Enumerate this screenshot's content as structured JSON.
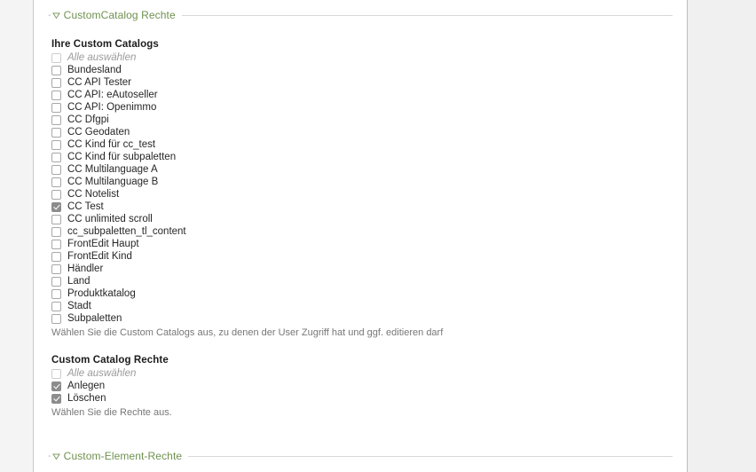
{
  "sections": [
    {
      "legend": "CustomCatalog Rechte",
      "toggle_icon": "triangle-down-icon",
      "accent_color": "#6f9150",
      "groups": [
        {
          "title": "Ihre Custom Catalogs",
          "select_all": {
            "label": "Alle auswählen",
            "checked": false
          },
          "options": [
            {
              "label": "Bundesland",
              "checked": false
            },
            {
              "label": "CC API Tester",
              "checked": false
            },
            {
              "label": "CC API: eAutoseller",
              "checked": false
            },
            {
              "label": "CC API: Openimmo",
              "checked": false
            },
            {
              "label": "CC Dfgpi",
              "checked": false
            },
            {
              "label": "CC Geodaten",
              "checked": false
            },
            {
              "label": "CC Kind für cc_test",
              "checked": false
            },
            {
              "label": "CC Kind für subpaletten",
              "checked": false
            },
            {
              "label": "CC Multilanguage A",
              "checked": false
            },
            {
              "label": "CC Multilanguage B",
              "checked": false
            },
            {
              "label": "CC Notelist",
              "checked": false
            },
            {
              "label": "CC Test",
              "checked": true
            },
            {
              "label": "CC unlimited scroll",
              "checked": false
            },
            {
              "label": "cc_subpaletten_tl_content",
              "checked": false
            },
            {
              "label": "FrontEdit Haupt",
              "checked": false
            },
            {
              "label": "FrontEdit Kind",
              "checked": false
            },
            {
              "label": "Händler",
              "checked": false
            },
            {
              "label": "Land",
              "checked": false
            },
            {
              "label": "Produktkatalog",
              "checked": false
            },
            {
              "label": "Stadt",
              "checked": false
            },
            {
              "label": "Subpaletten",
              "checked": false
            }
          ],
          "help": "Wählen Sie die Custom Catalogs aus, zu denen der User Zugriff hat und ggf. editieren darf"
        },
        {
          "title": "Custom Catalog Rechte",
          "select_all": {
            "label": "Alle auswählen",
            "checked": false
          },
          "options": [
            {
              "label": "Anlegen",
              "checked": true
            },
            {
              "label": "Löschen",
              "checked": true
            }
          ],
          "help": "Wählen Sie die Rechte aus."
        }
      ]
    },
    {
      "legend": "Custom-Element-Rechte",
      "toggle_icon": "triangle-down-icon",
      "accent_color": "#6f9150",
      "groups": []
    }
  ]
}
